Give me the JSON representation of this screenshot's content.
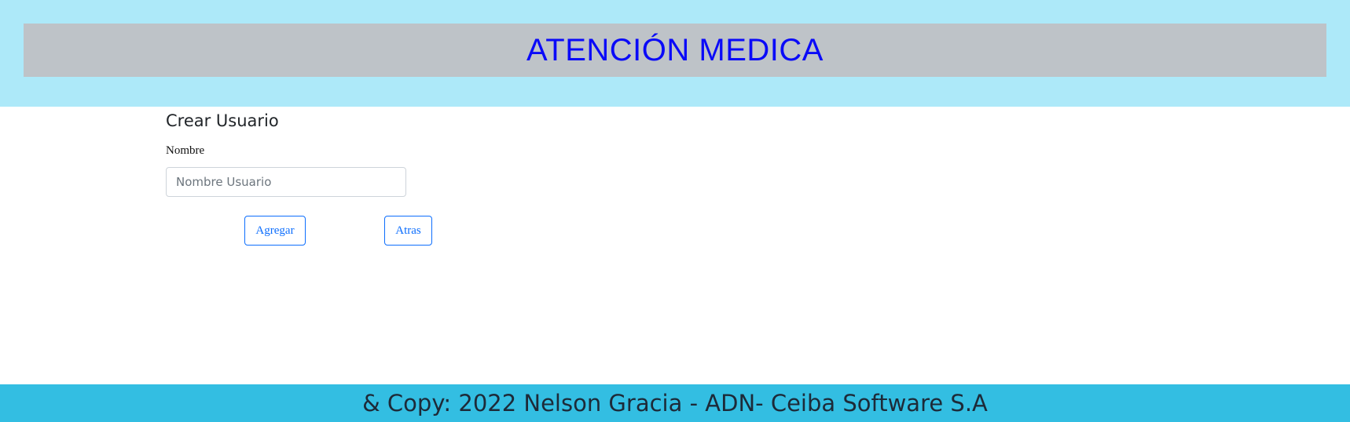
{
  "header": {
    "title": "ATENCIÓN MEDICA"
  },
  "form": {
    "heading": "Crear Usuario",
    "name_label": "Nombre",
    "name_placeholder": "Nombre Usuario",
    "name_value": "",
    "add_button_label": "Agregar",
    "back_button_label": "Atras"
  },
  "footer": {
    "text": "& Copy: 2022 Nelson Gracia - ADN- Ceiba Software S.A"
  },
  "colors": {
    "header_background": "#ade9f9",
    "header_bar": "#bec3c8",
    "header_title": "#0a0af8",
    "footer_background": "#33bee2",
    "button_accent": "#0d6efd"
  }
}
